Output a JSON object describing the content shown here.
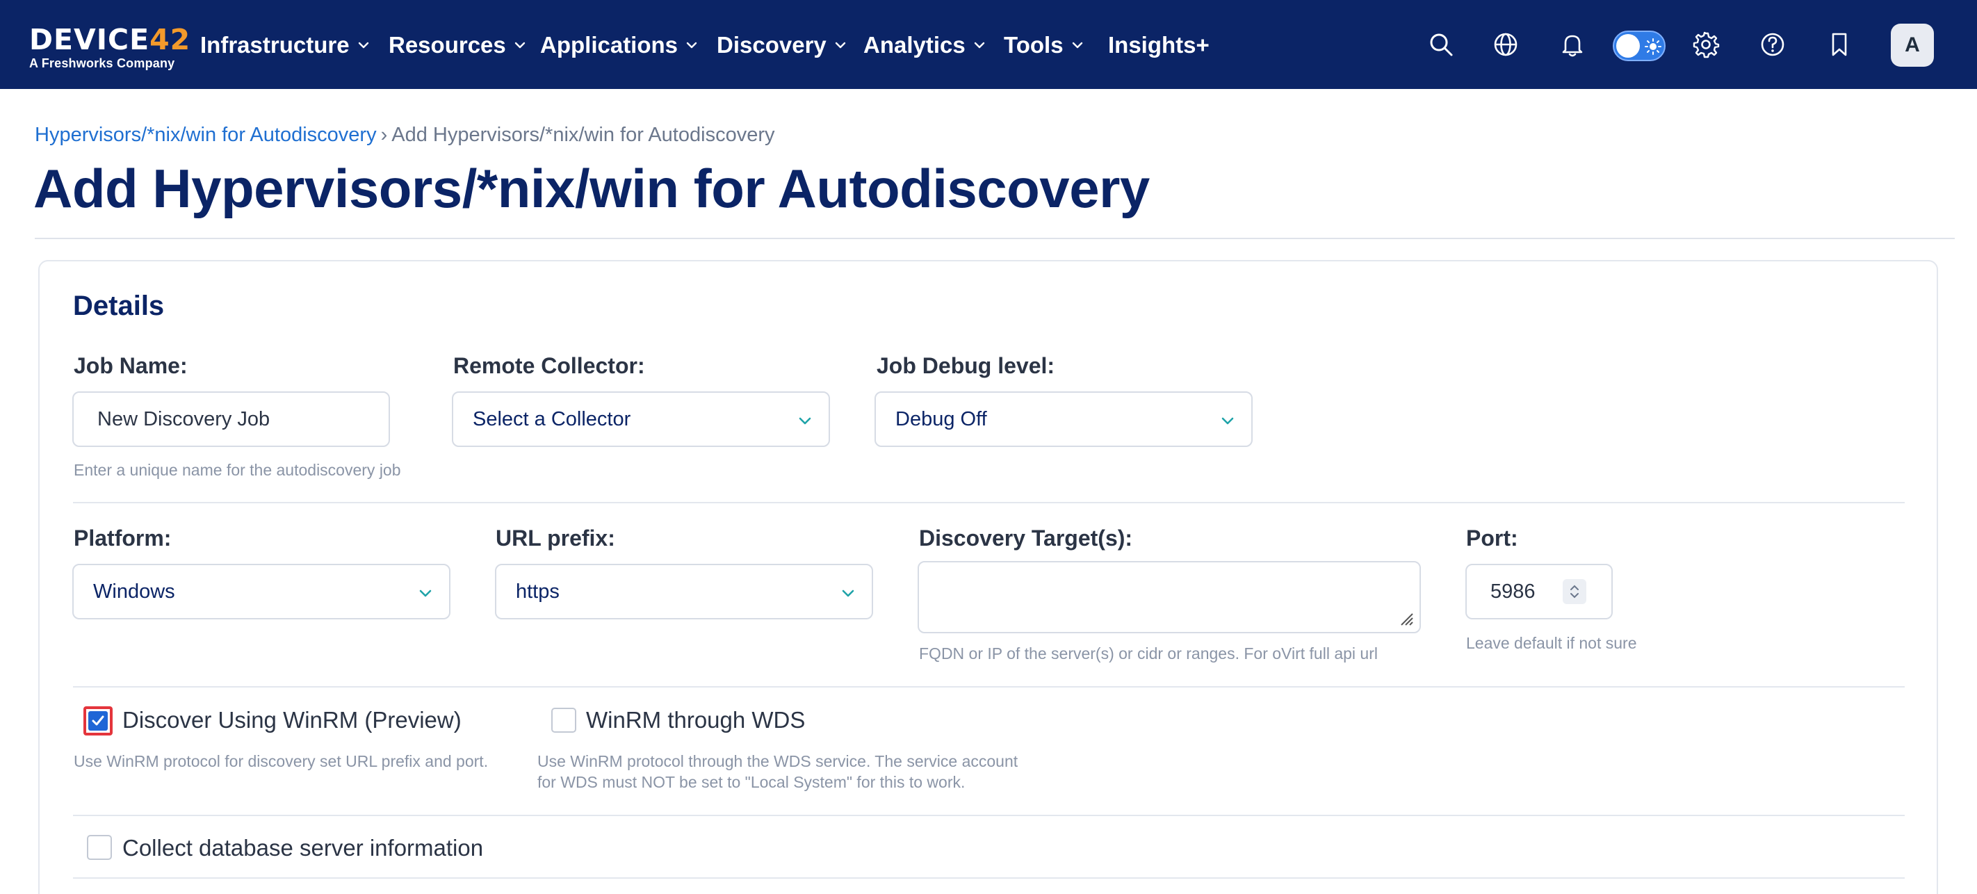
{
  "brand": {
    "logo_main": "DEVICE",
    "logo_accent": "42",
    "logo_sub": "A Freshworks Company",
    "accent_color": "#f39a2b",
    "nav_bg": "#0b2466"
  },
  "nav": {
    "items": [
      {
        "label": "Infrastructure",
        "dropdown": true
      },
      {
        "label": "Resources",
        "dropdown": true
      },
      {
        "label": "Applications",
        "dropdown": true
      },
      {
        "label": "Discovery",
        "dropdown": true
      },
      {
        "label": "Analytics",
        "dropdown": true
      },
      {
        "label": "Tools",
        "dropdown": true
      },
      {
        "label": "Insights+",
        "dropdown": false
      }
    ],
    "icons": [
      "search-icon",
      "globe-icon",
      "bell-icon",
      "theme-toggle",
      "gear-icon",
      "help-icon",
      "bookmark-icon"
    ],
    "avatar_initial": "A"
  },
  "breadcrumb": {
    "parent": "Hypervisors/*nix/win for Autodiscovery",
    "separator": "›",
    "current": "Add Hypervisors/*nix/win for Autodiscovery"
  },
  "page_title": "Add Hypervisors/*nix/win for Autodiscovery",
  "details": {
    "title": "Details",
    "job_name": {
      "label": "Job Name:",
      "value": "New Discovery Job",
      "help": "Enter a unique name for the autodiscovery job"
    },
    "remote_collector": {
      "label": "Remote Collector:",
      "value": "Select a Collector"
    },
    "job_debug": {
      "label": "Job Debug level:",
      "value": "Debug Off"
    },
    "platform": {
      "label": "Platform:",
      "value": "Windows"
    },
    "url_prefix": {
      "label": "URL prefix:",
      "value": "https"
    },
    "discovery_targets": {
      "label": "Discovery Target(s):",
      "value": "",
      "help": "FQDN or IP of the server(s) or cidr or ranges. For oVirt full api url"
    },
    "port": {
      "label": "Port:",
      "value": "5986",
      "help": "Leave default if not sure"
    },
    "winrm": {
      "label": "Discover Using WinRM (Preview)",
      "checked": true,
      "help": "Use WinRM protocol for discovery set URL prefix and port."
    },
    "winrm_wds": {
      "label": "WinRM through WDS",
      "checked": false,
      "help_line1": "Use WinRM protocol through the WDS service. The service account",
      "help_line2": "for WDS must NOT be set to \"Local System\" for this to work."
    },
    "collect_db": {
      "label": "Collect database server information",
      "checked": false
    }
  }
}
